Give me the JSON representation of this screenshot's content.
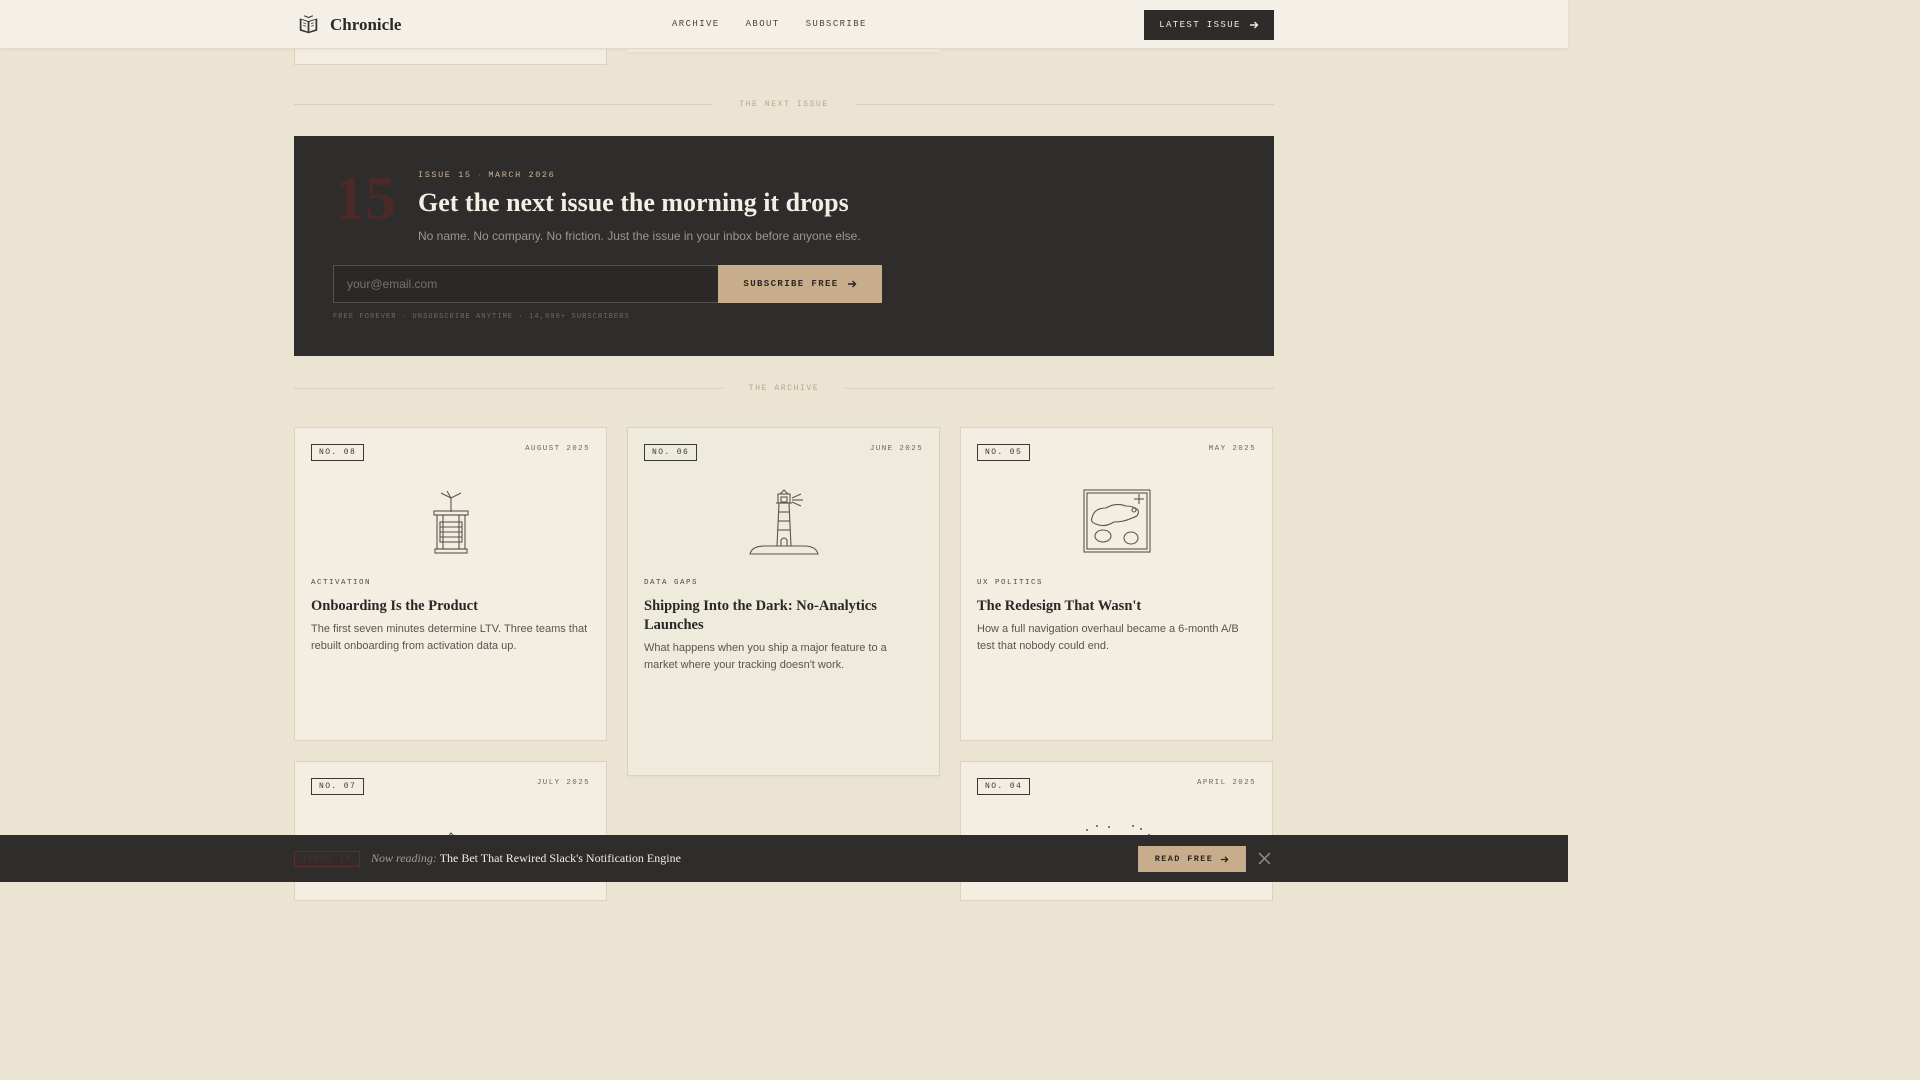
{
  "header": {
    "brand": "Chronicle",
    "nav": [
      "ARCHIVE",
      "ABOUT",
      "SUBSCRIBE"
    ],
    "latest_button": "LATEST ISSUE",
    "icons": {
      "brand": "open-book-icon",
      "arrow": "arrow-right-icon"
    }
  },
  "next_issue": {
    "section_label": "THE NEXT ISSUE",
    "number": "15",
    "meta_issue": "ISSUE 15",
    "meta_sep": "·",
    "meta_date": "MARCH 2026",
    "title": "Get the next issue the morning it drops",
    "subtitle": "No name. No company. No friction. Just the issue in your inbox before anyone else.",
    "email_placeholder": "your@email.com",
    "email_value": "",
    "subscribe_button": "SUBSCRIBE FREE",
    "fineprint": "FREE FOREVER · UNSUBSCRIBE ANYTIME · 14,800+ SUBSCRIBERS"
  },
  "archive": {
    "section_label": "THE ARCHIVE",
    "cards": [
      {
        "no": "NO. 08",
        "date": "AUGUST 2025",
        "tag": "ACTIVATION",
        "title": "Onboarding Is the Product",
        "desc": "The first seven minutes determine LTV. Three teams that rebuilt onboarding from activation data up.",
        "icon": "well-icon"
      },
      {
        "no": "NO. 06",
        "date": "JUNE 2025",
        "tag": "DATA GAPS",
        "title": "Shipping Into the Dark: No-Analytics Launches",
        "desc": "What happens when you ship a major feature to a market where your tracking doesn't work.",
        "icon": "lighthouse-icon"
      },
      {
        "no": "NO. 05",
        "date": "MAY 2025",
        "tag": "UX POLITICS",
        "title": "The Redesign That Wasn't",
        "desc": "How a full navigation overhaul became a 6-month A/B test that nobody could end.",
        "icon": "map-icon"
      },
      {
        "no": "NO. 07",
        "date": "JULY 2025"
      },
      {
        "no": "NO. 04",
        "date": "APRIL 2025"
      }
    ]
  },
  "reading_bar": {
    "badge": "ISSUE 16",
    "label": "Now reading:",
    "title": "The Bet That Rewired Slack's Notification Engine",
    "read_button": "READ FREE",
    "close_icon": "close-icon"
  },
  "colors": {
    "page_bg": "#ebe4d3",
    "header_bg": "#f4f0e7",
    "dark_panel": "#2e2d2b",
    "accent_tan": "#c8ad8d",
    "card_bg": "#f3ede2"
  }
}
